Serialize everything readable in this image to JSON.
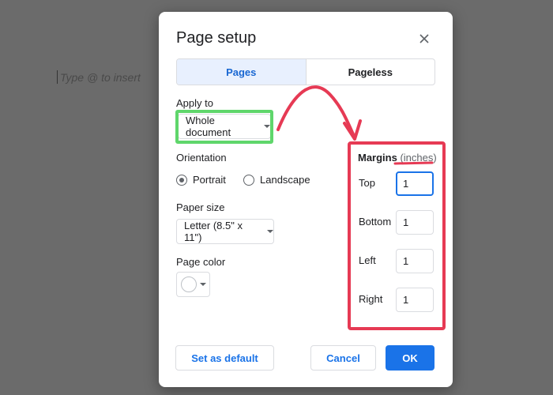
{
  "doc": {
    "placeholder": "Type @ to insert"
  },
  "dialog": {
    "title": "Page setup",
    "tabs": [
      {
        "label": "Pages",
        "active": true
      },
      {
        "label": "Pageless",
        "active": false
      }
    ],
    "apply_to": {
      "label": "Apply to",
      "value": "Whole document"
    },
    "orientation": {
      "label": "Orientation",
      "options": [
        {
          "label": "Portrait",
          "selected": true
        },
        {
          "label": "Landscape",
          "selected": false
        }
      ]
    },
    "paper_size": {
      "label": "Paper size",
      "value": "Letter (8.5\" x 11\")"
    },
    "page_color": {
      "label": "Page color",
      "value": "#ffffff"
    },
    "margins": {
      "label": "Margins",
      "unit": "(inches)",
      "fields": [
        {
          "label": "Top",
          "value": "1"
        },
        {
          "label": "Bottom",
          "value": "1"
        },
        {
          "label": "Left",
          "value": "1"
        },
        {
          "label": "Right",
          "value": "1"
        }
      ]
    },
    "buttons": {
      "set_default": "Set as default",
      "cancel": "Cancel",
      "ok": "OK"
    }
  },
  "annotations": {
    "green": "#5fd66b",
    "red": "#e63a54"
  },
  "colors": {
    "accent": "#1a73e8",
    "overlay": "#6b6b6b"
  }
}
